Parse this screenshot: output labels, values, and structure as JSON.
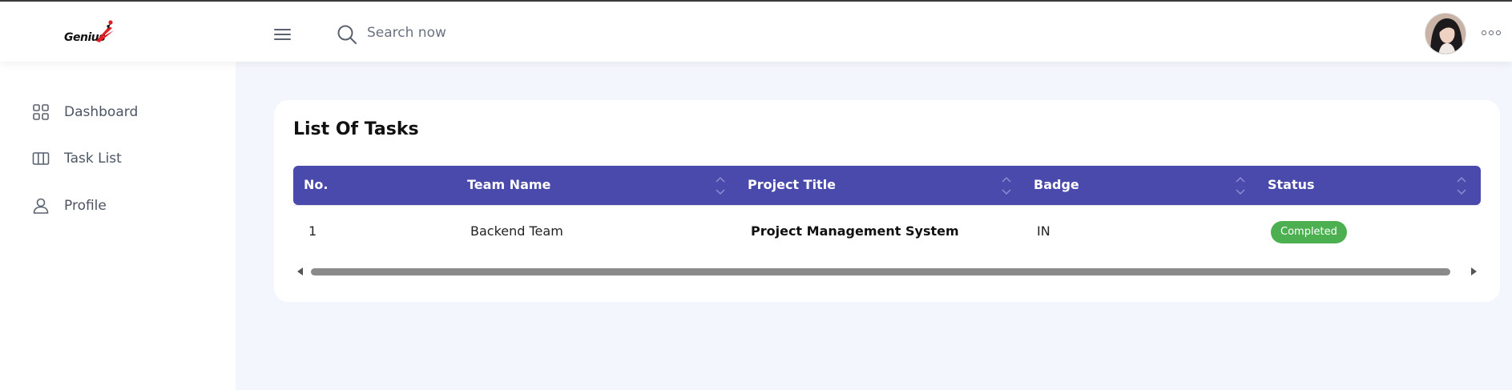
{
  "header": {
    "logo_text": "Genius",
    "search": {
      "placeholder": "Search now",
      "value": ""
    },
    "menu_icon": "hamburger-icon",
    "more_icon": "more-dots-icon"
  },
  "sidebar": {
    "items": [
      {
        "label": "Dashboard",
        "icon": "grid-icon"
      },
      {
        "label": "Task List",
        "icon": "columns-icon"
      },
      {
        "label": "Profile",
        "icon": "user-icon"
      }
    ]
  },
  "main": {
    "title": "List Of Tasks",
    "table": {
      "columns": [
        "No.",
        "Team Name",
        "Project Title",
        "Badge",
        "Status"
      ],
      "rows": [
        {
          "no": "1",
          "team": "Backend Team",
          "project": "Project Management System",
          "badge": "IN",
          "status": "Completed"
        }
      ]
    }
  },
  "colors": {
    "table_header": "#4a4aad",
    "status_completed": "#4caf50",
    "background": "#f4f6fd",
    "logo_accent": "#e31e24"
  }
}
